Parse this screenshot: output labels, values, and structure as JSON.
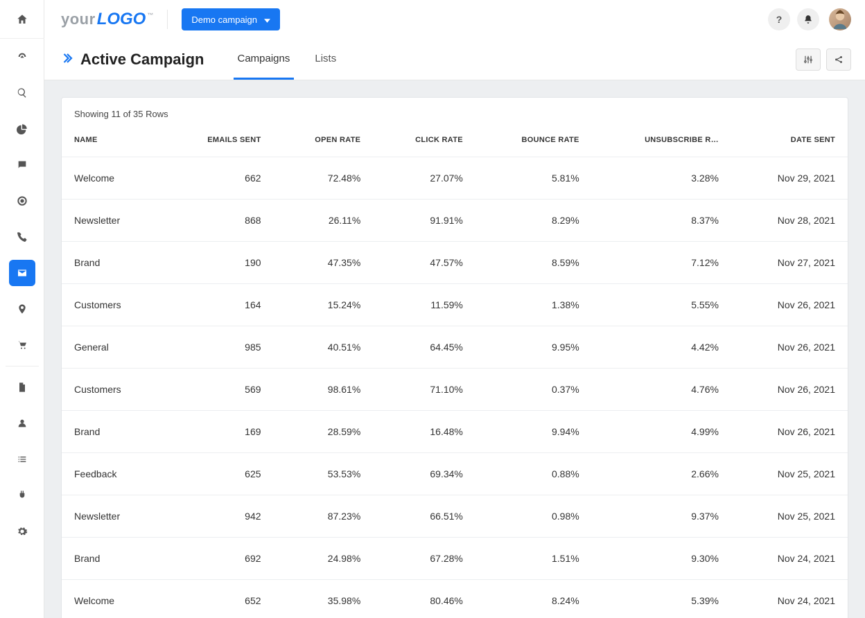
{
  "brand": {
    "part1": "your",
    "part2": "LOGO",
    "tm": "™"
  },
  "topbar": {
    "campaign_button": "Demo campaign"
  },
  "page": {
    "title": "Active Campaign",
    "tabs": [
      {
        "label": "Campaigns",
        "active": true
      },
      {
        "label": "Lists",
        "active": false
      }
    ]
  },
  "table": {
    "showing": "Showing 11 of 35 Rows",
    "headers": {
      "name": "NAME",
      "emails_sent": "EMAILS SENT",
      "open_rate": "OPEN RATE",
      "click_rate": "CLICK RATE",
      "bounce_rate": "BOUNCE RATE",
      "unsubscribe_rate": "UNSUBSCRIBE R…",
      "date_sent": "DATE SENT"
    },
    "rows": [
      {
        "name": "Welcome",
        "emails_sent": "662",
        "open_rate": "72.48%",
        "click_rate": "27.07%",
        "bounce_rate": "5.81%",
        "unsubscribe_rate": "3.28%",
        "date_sent": "Nov 29, 2021"
      },
      {
        "name": "Newsletter",
        "emails_sent": "868",
        "open_rate": "26.11%",
        "click_rate": "91.91%",
        "bounce_rate": "8.29%",
        "unsubscribe_rate": "8.37%",
        "date_sent": "Nov 28, 2021"
      },
      {
        "name": "Brand",
        "emails_sent": "190",
        "open_rate": "47.35%",
        "click_rate": "47.57%",
        "bounce_rate": "8.59%",
        "unsubscribe_rate": "7.12%",
        "date_sent": "Nov 27, 2021"
      },
      {
        "name": "Customers",
        "emails_sent": "164",
        "open_rate": "15.24%",
        "click_rate": "11.59%",
        "bounce_rate": "1.38%",
        "unsubscribe_rate": "5.55%",
        "date_sent": "Nov 26, 2021"
      },
      {
        "name": "General",
        "emails_sent": "985",
        "open_rate": "40.51%",
        "click_rate": "64.45%",
        "bounce_rate": "9.95%",
        "unsubscribe_rate": "4.42%",
        "date_sent": "Nov 26, 2021"
      },
      {
        "name": "Customers",
        "emails_sent": "569",
        "open_rate": "98.61%",
        "click_rate": "71.10%",
        "bounce_rate": "0.37%",
        "unsubscribe_rate": "4.76%",
        "date_sent": "Nov 26, 2021"
      },
      {
        "name": "Brand",
        "emails_sent": "169",
        "open_rate": "28.59%",
        "click_rate": "16.48%",
        "bounce_rate": "9.94%",
        "unsubscribe_rate": "4.99%",
        "date_sent": "Nov 26, 2021"
      },
      {
        "name": "Feedback",
        "emails_sent": "625",
        "open_rate": "53.53%",
        "click_rate": "69.34%",
        "bounce_rate": "0.88%",
        "unsubscribe_rate": "2.66%",
        "date_sent": "Nov 25, 2021"
      },
      {
        "name": "Newsletter",
        "emails_sent": "942",
        "open_rate": "87.23%",
        "click_rate": "66.51%",
        "bounce_rate": "0.98%",
        "unsubscribe_rate": "9.37%",
        "date_sent": "Nov 25, 2021"
      },
      {
        "name": "Brand",
        "emails_sent": "692",
        "open_rate": "24.98%",
        "click_rate": "67.28%",
        "bounce_rate": "1.51%",
        "unsubscribe_rate": "9.30%",
        "date_sent": "Nov 24, 2021"
      },
      {
        "name": "Welcome",
        "emails_sent": "652",
        "open_rate": "35.98%",
        "click_rate": "80.46%",
        "bounce_rate": "8.24%",
        "unsubscribe_rate": "5.39%",
        "date_sent": "Nov 24, 2021"
      }
    ]
  }
}
